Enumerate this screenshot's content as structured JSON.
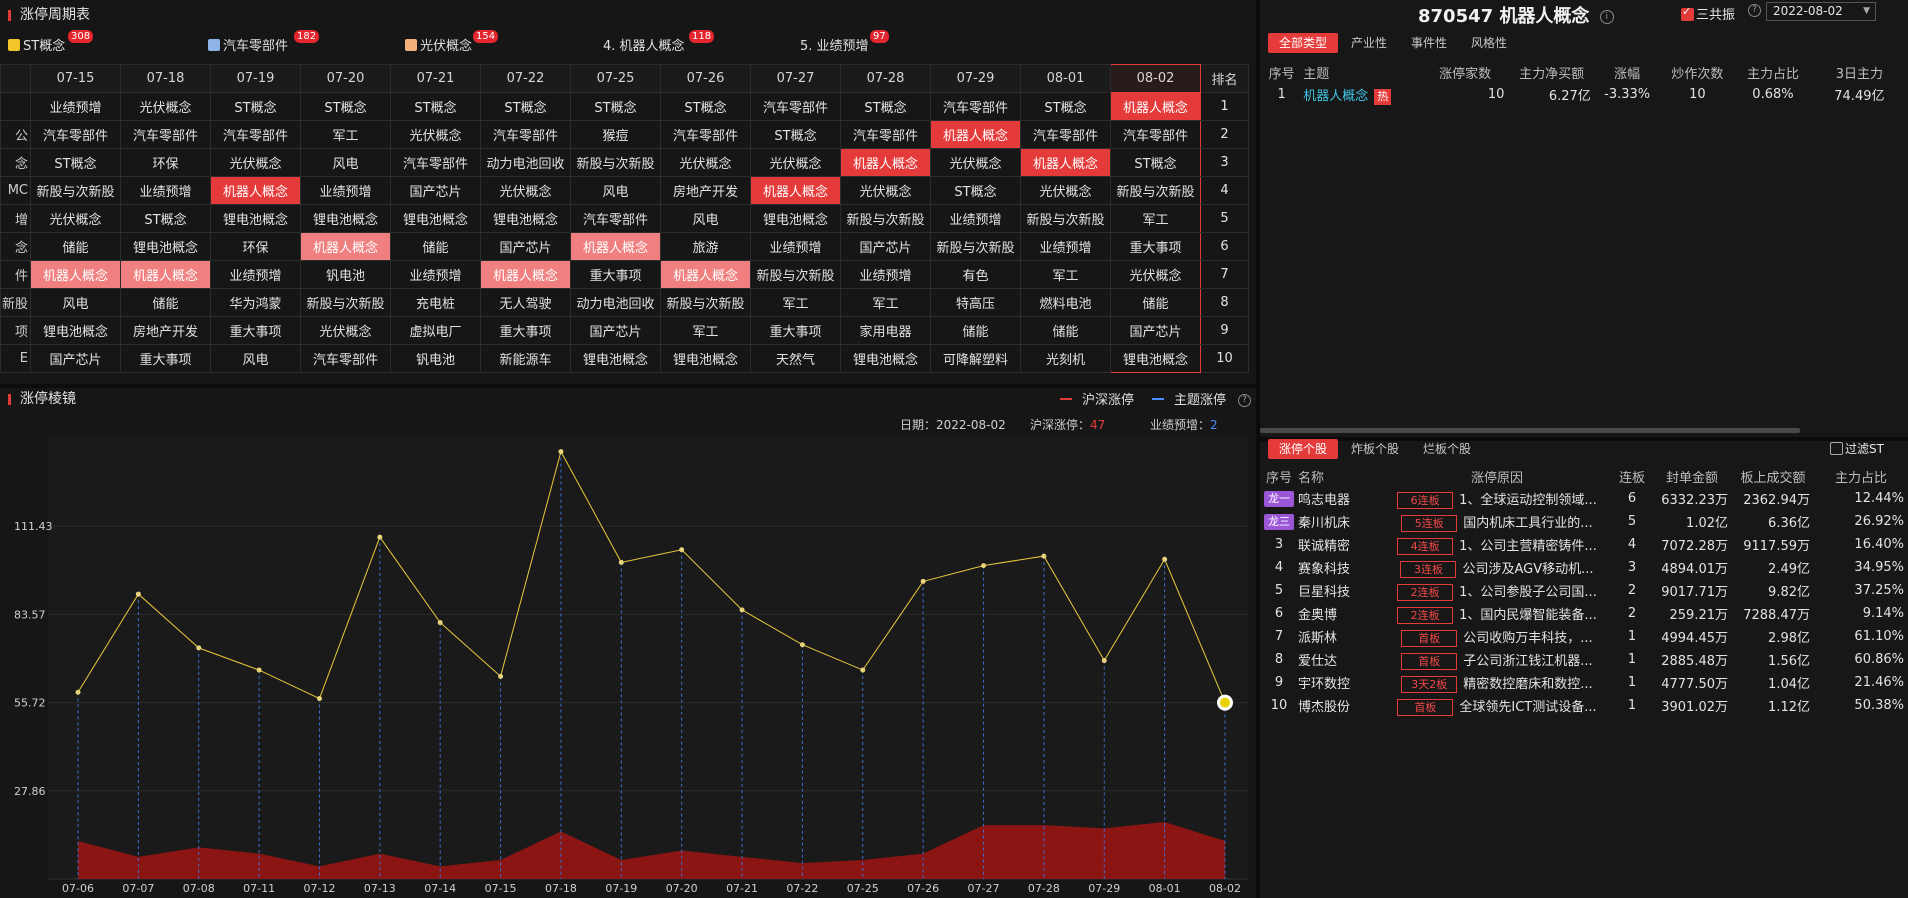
{
  "cycle": {
    "title": "涨停周期表",
    "legend": [
      {
        "label": "ST概念",
        "count": "308",
        "color": "#f2c629"
      },
      {
        "label": "汽车零部件",
        "count": "182",
        "color": "#8fb4e8"
      },
      {
        "label": "光伏概念",
        "count": "154",
        "color": "#f3b07a"
      },
      {
        "label": "4. 机器人概念",
        "count": "118",
        "color": ""
      },
      {
        "label": "5. 业绩预增",
        "count": "97",
        "color": ""
      }
    ],
    "rank_header": "排名",
    "dates": [
      "07-15",
      "07-18",
      "07-19",
      "07-20",
      "07-21",
      "07-22",
      "07-25",
      "07-26",
      "07-27",
      "07-28",
      "07-29",
      "08-01",
      "08-02"
    ],
    "cut_column": [
      "",
      "公",
      "念",
      "MC",
      "增",
      "念",
      "件",
      "新股",
      "项",
      "E"
    ],
    "rows": [
      {
        "rank": "1",
        "cells": [
          "业绩预增",
          "光伏概念",
          "ST概念",
          "ST概念",
          "ST概念",
          "ST概念",
          "ST概念",
          "ST概念",
          "汽车零部件",
          "ST概念",
          "汽车零部件",
          "ST概念",
          "机器人概念"
        ]
      },
      {
        "rank": "2",
        "cells": [
          "汽车零部件",
          "汽车零部件",
          "汽车零部件",
          "军工",
          "光伏概念",
          "汽车零部件",
          "猴痘",
          "汽车零部件",
          "ST概念",
          "汽车零部件",
          "机器人概念",
          "汽车零部件",
          "汽车零部件"
        ]
      },
      {
        "rank": "3",
        "cells": [
          "ST概念",
          "环保",
          "光伏概念",
          "风电",
          "汽车零部件",
          "动力电池回收",
          "新股与次新股",
          "光伏概念",
          "光伏概念",
          "机器人概念",
          "光伏概念",
          "机器人概念",
          "ST概念"
        ]
      },
      {
        "rank": "4",
        "cells": [
          "新股与次新股",
          "业绩预增",
          "机器人概念",
          "业绩预增",
          "国产芯片",
          "光伏概念",
          "风电",
          "房地产开发",
          "机器人概念",
          "光伏概念",
          "ST概念",
          "光伏概念",
          "新股与次新股"
        ]
      },
      {
        "rank": "5",
        "cells": [
          "光伏概念",
          "ST概念",
          "锂电池概念",
          "锂电池概念",
          "锂电池概念",
          "锂电池概念",
          "汽车零部件",
          "风电",
          "锂电池概念",
          "新股与次新股",
          "业绩预增",
          "新股与次新股",
          "军工"
        ]
      },
      {
        "rank": "6",
        "cells": [
          "储能",
          "锂电池概念",
          "环保",
          "机器人概念",
          "储能",
          "国产芯片",
          "机器人概念",
          "旅游",
          "业绩预增",
          "国产芯片",
          "新股与次新股",
          "业绩预增",
          "重大事项"
        ]
      },
      {
        "rank": "7",
        "cells": [
          "机器人概念",
          "机器人概念",
          "业绩预增",
          "钒电池",
          "业绩预增",
          "机器人概念",
          "重大事项",
          "机器人概念",
          "新股与次新股",
          "业绩预增",
          "有色",
          "军工",
          "光伏概念"
        ]
      },
      {
        "rank": "8",
        "cells": [
          "风电",
          "储能",
          "华为鸿蒙",
          "新股与次新股",
          "充电桩",
          "无人驾驶",
          "动力电池回收",
          "新股与次新股",
          "军工",
          "军工",
          "特高压",
          "燃料电池",
          "储能"
        ]
      },
      {
        "rank": "9",
        "cells": [
          "锂电池概念",
          "房地产开发",
          "重大事项",
          "光伏概念",
          "虚拟电厂",
          "重大事项",
          "国产芯片",
          "军工",
          "重大事项",
          "家用电器",
          "储能",
          "储能",
          "国产芯片"
        ]
      },
      {
        "rank": "10",
        "cells": [
          "国产芯片",
          "重大事项",
          "风电",
          "汽车零部件",
          "钒电池",
          "新能源车",
          "锂电池概念",
          "锂电池概念",
          "天然气",
          "锂电池概念",
          "可降解塑料",
          "光刻机",
          "锂电池概念"
        ]
      }
    ]
  },
  "mirror": {
    "title": "涨停棱镜",
    "legend_a": "沪深涨停",
    "legend_b": "主题涨停",
    "date_label": "日期：",
    "date_value": "2022-08-02",
    "count_label": "沪深涨停：",
    "count_value": "47",
    "theme_label": "业绩预增：",
    "theme_value": "2",
    "line_color": "#e8c93c",
    "area_color": "#8b1513"
  },
  "chart_data": {
    "type": "line",
    "title": "",
    "x": [
      "07-06",
      "07-07",
      "07-08",
      "07-11",
      "07-12",
      "07-13",
      "07-14",
      "07-15",
      "07-18",
      "07-19",
      "07-20",
      "07-21",
      "07-22",
      "07-25",
      "07-26",
      "07-27",
      "07-28",
      "07-29",
      "08-01",
      "08-02"
    ],
    "yticks": [
      27.86,
      55.72,
      83.57,
      111.43
    ],
    "ylim": [
      0,
      139.3
    ],
    "series": [
      {
        "values": [
          59,
          90,
          73,
          66,
          57,
          108,
          81,
          64,
          135,
          100,
          104,
          85,
          74,
          66,
          94,
          99,
          102,
          69,
          101,
          55.72
        ]
      },
      {
        "values": [
          12,
          7,
          10,
          8,
          4,
          8,
          4,
          6,
          15,
          6,
          9,
          7,
          5,
          6,
          8,
          17,
          17,
          16,
          18,
          12
        ]
      }
    ],
    "grid": true
  },
  "header": {
    "code": "870547",
    "name": "机器人概念",
    "sangongzhen": "三共振",
    "date": "2022-08-02"
  },
  "theme_tabs": [
    "全部类型",
    "产业性",
    "事件性",
    "风格性"
  ],
  "theme_table": {
    "columns": [
      "序号",
      "主题",
      "涨停家数",
      "主力净买额",
      "涨幅",
      "炒作次数",
      "主力占比",
      "3日主力"
    ],
    "rows": [
      {
        "idx": "1",
        "name": "机器人概念",
        "hot": "热",
        "count": "10",
        "net": "6.27亿",
        "chg": "-3.33%",
        "times": "10",
        "ratio": "0.68%",
        "d3": "74.49亿"
      }
    ]
  },
  "stock_tabs": [
    "涨停个股",
    "炸板个股",
    "烂板个股"
  ],
  "filter_st": "过滤ST",
  "stock_table": {
    "columns": [
      "序号",
      "名称",
      "涨停原因",
      "连板",
      "封单金额",
      "板上成交额",
      "主力占比"
    ],
    "rows": [
      {
        "idx": "龙一",
        "badge": true,
        "name": "鸣志电器",
        "color": "yellow",
        "lb": "6连板",
        "reason": "1、全球运动控制领域...",
        "n": "6",
        "seal": "6332.23万",
        "turnover": "2362.94万",
        "ratio": "12.44%"
      },
      {
        "idx": "龙三",
        "badge": true,
        "name": "秦川机床",
        "color": "yellow",
        "lb": "5连板",
        "reason": "国内机床工具行业的...",
        "n": "5",
        "seal": "1.02亿",
        "turnover": "6.36亿",
        "ratio": "26.92%"
      },
      {
        "idx": "3",
        "badge": false,
        "name": "联诚精密",
        "color": "yellow",
        "lb": "4连板",
        "reason": "1、公司主营精密铸件...",
        "n": "4",
        "seal": "7072.28万",
        "turnover": "9117.59万",
        "ratio": "16.40%"
      },
      {
        "idx": "4",
        "badge": false,
        "name": "赛象科技",
        "color": "cyan",
        "lb": "3连板",
        "reason": "公司涉及AGV移动机...",
        "n": "3",
        "seal": "4894.01万",
        "turnover": "2.49亿",
        "ratio": "34.95%"
      },
      {
        "idx": "5",
        "badge": false,
        "name": "巨星科技",
        "color": "cyan",
        "lb": "2连板",
        "reason": "1、公司参股子公司国...",
        "n": "2",
        "seal": "9017.71万",
        "turnover": "9.82亿",
        "ratio": "37.25%"
      },
      {
        "idx": "6",
        "badge": false,
        "name": "金奥博",
        "color": "cyan",
        "lb": "2连板",
        "reason": "1、国内民爆智能装备...",
        "n": "2",
        "seal": "259.21万",
        "turnover": "7288.47万",
        "ratio": "9.14%"
      },
      {
        "idx": "7",
        "badge": false,
        "name": "派斯林",
        "color": "cyan",
        "lb": "首板",
        "reason": "公司收购万丰科技，...",
        "n": "1",
        "seal": "4994.45万",
        "turnover": "2.98亿",
        "ratio": "61.10%"
      },
      {
        "idx": "8",
        "badge": false,
        "name": "爱仕达",
        "color": "yellow",
        "lb": "首板",
        "reason": "子公司浙江钱江机器...",
        "n": "1",
        "seal": "2885.48万",
        "turnover": "1.56亿",
        "ratio": "60.86%"
      },
      {
        "idx": "9",
        "badge": false,
        "name": "宇环数控",
        "color": "cyan",
        "lb": "3天2板",
        "reason": "精密数控磨床和数控...",
        "n": "1",
        "seal": "4777.50万",
        "turnover": "1.04亿",
        "ratio": "21.46%"
      },
      {
        "idx": "10",
        "badge": false,
        "name": "博杰股份",
        "color": "cyan",
        "lb": "首板",
        "reason": "全球领先ICT测试设备...",
        "n": "1",
        "seal": "3901.02万",
        "turnover": "1.12亿",
        "ratio": "50.38%"
      }
    ]
  }
}
